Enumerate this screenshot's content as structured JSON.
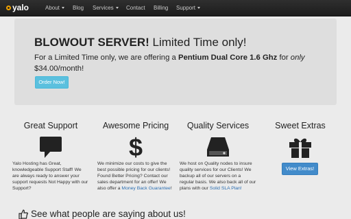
{
  "navbar": {
    "brand": "yalo",
    "items": [
      {
        "label": "About",
        "dropdown": true
      },
      {
        "label": "Blog",
        "dropdown": false
      },
      {
        "label": "Services",
        "dropdown": true
      },
      {
        "label": "Contact",
        "dropdown": false
      },
      {
        "label": "Billing",
        "dropdown": false
      },
      {
        "label": "Support",
        "dropdown": true
      }
    ]
  },
  "hero": {
    "title_bold": "BLOWOUT SERVER!",
    "title_rest": " Limited Time only!",
    "text_1": "For a Limited Time only, we are offering a ",
    "text_bold": "Pentium Dual Core 1.6 Ghz",
    "text_2": " for ",
    "text_italic": "only",
    "text_3": "$34.00/month!",
    "button": "Order Now!"
  },
  "features": [
    {
      "title": "Great Support",
      "icon": "speech-bubble-icon",
      "text": "Yalo Hosting has Great, knowledgeable Support Staff! We are always ready to answer your support requests Not Happy with our Support?"
    },
    {
      "title": "Awesome Pricing",
      "icon": "dollar-icon",
      "text": "We minimize our costs to give the best possible pricing for our clients! Found Better Pricing? Contact our sales department for an offer! We also offer a ",
      "link": "Money Back Guarantee",
      "text_end": "!"
    },
    {
      "title": "Quality Services",
      "icon": "hard-drive-icon",
      "text": "We host on Quality nodes to insure quality services for our Clients! We backup all of our servers on a regular basis. We also back all of our plans with our ",
      "link": "Solid SLA Plan!"
    },
    {
      "title": "Sweet Extras",
      "icon": "gift-icon",
      "button": "View Extras!"
    }
  ],
  "testimonials": {
    "heading": "See what people are saying about us!",
    "icon": "thumbs-up-icon"
  },
  "colors": {
    "navbar": "#1c1c1c",
    "hero_bg": "#dedede",
    "page_bg": "#ebebeb",
    "info_button": "#5bc0de",
    "primary_button": "#428bca",
    "logo_accent": "#f2a300",
    "link": "#2a6db0"
  }
}
